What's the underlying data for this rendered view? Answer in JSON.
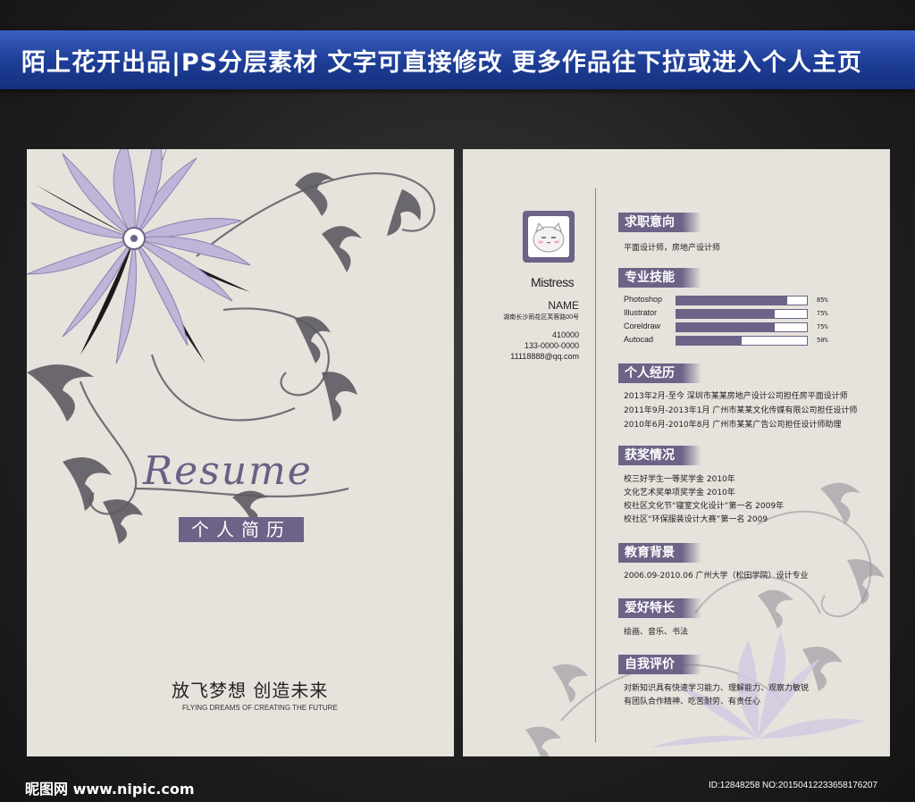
{
  "banner": {
    "text": "陌上花开出品|PS分层素材 文字可直接修改 更多作品往下拉或进入个人主页"
  },
  "cover": {
    "script_title": "Resume",
    "cn_title": "个人简历",
    "slogan_cn": "放飞梦想  创造未来",
    "slogan_en": "FLYING DREAMS OF CREATING THE FUTURE"
  },
  "profile": {
    "nickname": "Mistress",
    "name": "NAME",
    "address": "湖南长沙雨花区芙蓉路00号",
    "postcode": "410000",
    "phone": "133-0000-0000",
    "email": "11118888@qq.com"
  },
  "sections": {
    "job": {
      "title": "求职意向",
      "lines": [
        "平面设计师，房地产设计师"
      ]
    },
    "skills": {
      "title": "专业技能",
      "items": [
        {
          "name": "Photoshop",
          "percent": 85,
          "label": "85%"
        },
        {
          "name": "Illustrator",
          "percent": 75,
          "label": "75%"
        },
        {
          "name": "Coreldraw",
          "percent": 75,
          "label": "75%"
        },
        {
          "name": "Autocad",
          "percent": 50,
          "label": "50%"
        }
      ]
    },
    "experience": {
      "title": "个人经历",
      "lines": [
        "2013年2月-至今  深圳市某某房地产设计公司担任房平面设计师",
        "2011年9月-2013年1月  广州市某某文化传媒有限公司担任设计师",
        "2010年6月-2010年8月  广州市某某广告公司担任设计师助理"
      ]
    },
    "awards": {
      "title": "获奖情况",
      "lines": [
        "校三好学生一等奖学金  2010年",
        "文化艺术奖单项奖学金  2010年",
        "校社区文化节“寝室文化设计”第一名 2009年",
        "校社区“环保服装设计大赛”第一名 2009"
      ]
    },
    "education": {
      "title": "教育背景",
      "lines": [
        "2006.09-2010.06 广州大学（松田学院）设计专业"
      ]
    },
    "hobbies": {
      "title": "爱好特长",
      "lines": [
        "绘画、音乐、书法"
      ]
    },
    "self_eval": {
      "title": "自我评价",
      "lines": [
        "对新知识具有快速学习能力、理解能力、观察力敏锐",
        "有团队合作精神、吃苦耐劳、有责任心"
      ]
    }
  },
  "watermark": {
    "left": "昵图网 www.nipic.com",
    "right": "ID:12848258 NO:20150412233658176207"
  },
  "colors": {
    "accent": "#6d6287",
    "paper": "#e6e2dc",
    "petal": "#c0b4d9",
    "swirl": "#5e5a63",
    "banner": "#1d3d95"
  }
}
